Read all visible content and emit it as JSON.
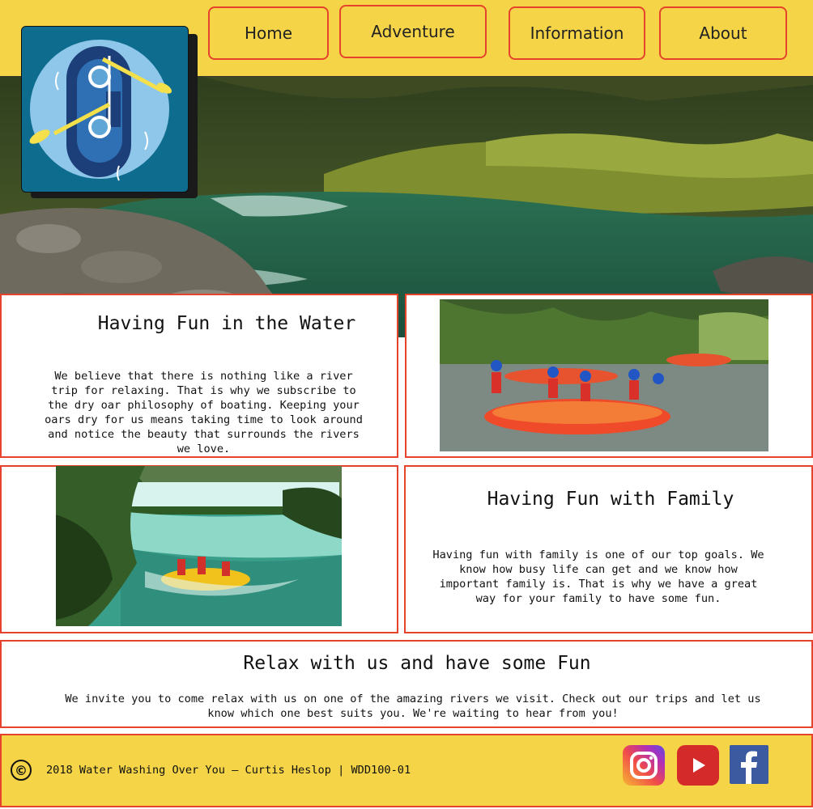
{
  "nav": {
    "items": [
      {
        "label": "Home"
      },
      {
        "label": "Adventure"
      },
      {
        "label": "Information"
      },
      {
        "label": "About"
      }
    ]
  },
  "sections": {
    "water": {
      "title": "Having Fun in the Water",
      "body": "We believe that there is nothing like a river trip for relaxing. That is why we subscribe to the dry oar philosophy of boating. Keeping your oars dry for us means taking time to look around and notice the beauty that surrounds the rivers we love."
    },
    "family": {
      "title": "Having Fun with Family",
      "body": "Having fun with family is one of our top goals. We know how busy life can get and we know how important family is. That is why we have a great way for your family to have some fun."
    },
    "relax": {
      "title": "Relax with us and have some Fun",
      "body": "We invite you to come relax with us on one of the amazing rivers we visit. Check out our trips and let us know which one best suits you. We're waiting to hear from you!"
    }
  },
  "footer": {
    "copyright_symbol": "©",
    "text": "2018 Water Washing Over You – Curtis Heslop | WDD100-01"
  },
  "social": [
    "instagram-icon",
    "youtube-icon",
    "facebook-icon"
  ],
  "colors": {
    "header": "#f5d547",
    "accent_border": "#e5432b",
    "logo_bg": "#0e6d8e"
  }
}
